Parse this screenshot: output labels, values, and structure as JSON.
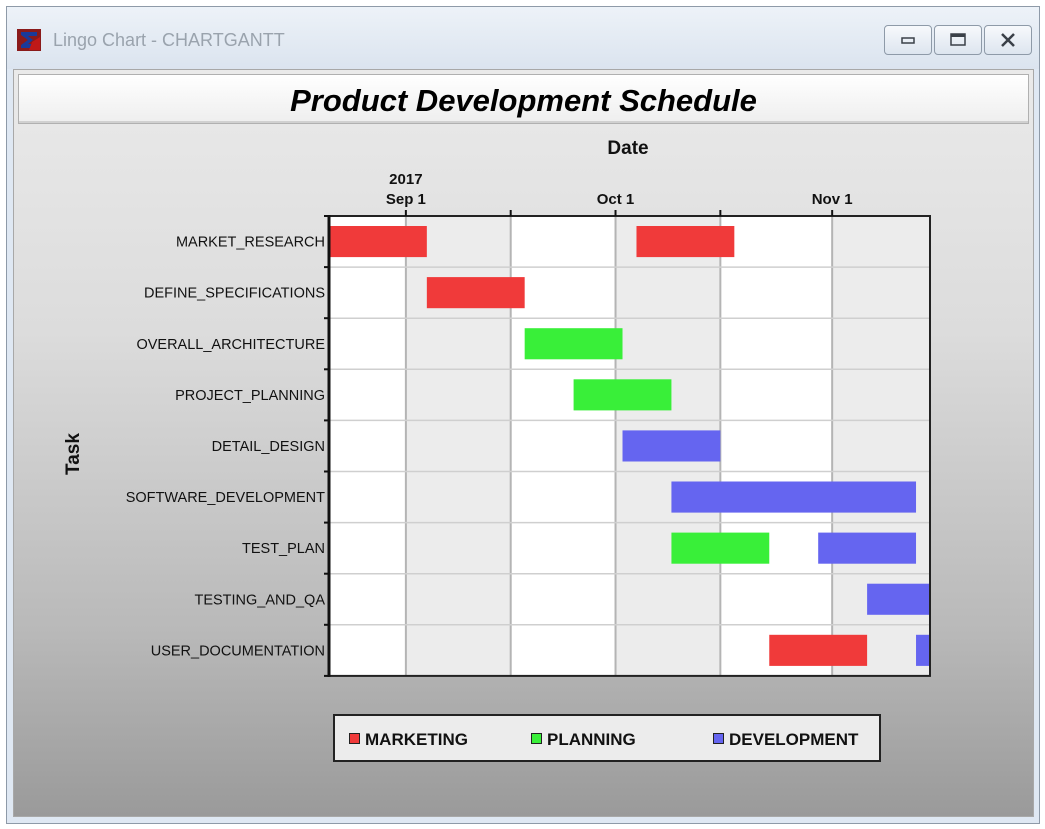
{
  "window": {
    "title": "Lingo Chart - CHARTGANTT",
    "buttons": {
      "minimize": "minimize-icon",
      "maximize": "maximize-icon",
      "close": "close-icon"
    }
  },
  "chart_data": {
    "type": "gantt",
    "title": "Product Development Schedule",
    "xlabel": "Date",
    "ylabel": "Task",
    "date_range": [
      "2017-08-21",
      "2017-11-15"
    ],
    "ticks": [
      {
        "date": "2017-09-01",
        "labels": [
          "2017",
          "Sep 1"
        ]
      },
      {
        "date": "2017-10-01",
        "labels": [
          "Oct 1"
        ]
      },
      {
        "date": "2017-11-01",
        "labels": [
          "Nov 1"
        ]
      }
    ],
    "gridlines": [
      "2017-09-01",
      "2017-09-16",
      "2017-10-01",
      "2017-10-16",
      "2017-11-01",
      "2017-11-16"
    ],
    "grid": true,
    "legend_position": "bottom",
    "categories": [
      {
        "name": "MARKETING",
        "color": "#f03a3a"
      },
      {
        "name": "PLANNING",
        "color": "#39ef39"
      },
      {
        "name": "DEVELOPMENT",
        "color": "#6565f0"
      }
    ],
    "tasks": [
      {
        "name": "MARKET_RESEARCH",
        "bars": [
          {
            "start": "2017-08-21",
            "end": "2017-09-04",
            "category": "MARKETING"
          },
          {
            "start": "2017-10-04",
            "end": "2017-10-18",
            "category": "MARKETING"
          }
        ]
      },
      {
        "name": "DEFINE_SPECIFICATIONS",
        "bars": [
          {
            "start": "2017-09-04",
            "end": "2017-09-18",
            "category": "MARKETING"
          }
        ]
      },
      {
        "name": "OVERALL_ARCHITECTURE",
        "bars": [
          {
            "start": "2017-09-18",
            "end": "2017-10-02",
            "category": "PLANNING"
          }
        ]
      },
      {
        "name": "PROJECT_PLANNING",
        "bars": [
          {
            "start": "2017-09-25",
            "end": "2017-10-09",
            "category": "PLANNING"
          }
        ]
      },
      {
        "name": "DETAIL_DESIGN",
        "bars": [
          {
            "start": "2017-10-02",
            "end": "2017-10-16",
            "category": "DEVELOPMENT"
          }
        ]
      },
      {
        "name": "SOFTWARE_DEVELOPMENT",
        "bars": [
          {
            "start": "2017-10-09",
            "end": "2017-11-13",
            "category": "DEVELOPMENT"
          }
        ]
      },
      {
        "name": "TEST_PLAN",
        "bars": [
          {
            "start": "2017-10-09",
            "end": "2017-10-23",
            "category": "PLANNING"
          },
          {
            "start": "2017-10-30",
            "end": "2017-11-13",
            "category": "DEVELOPMENT"
          }
        ]
      },
      {
        "name": "TESTING_AND_QA",
        "bars": [
          {
            "start": "2017-11-06",
            "end": "2017-11-27",
            "category": "DEVELOPMENT"
          }
        ]
      },
      {
        "name": "USER_DOCUMENTATION",
        "bars": [
          {
            "start": "2017-10-23",
            "end": "2017-11-06",
            "category": "MARKETING"
          },
          {
            "start": "2017-11-13",
            "end": "2017-11-27",
            "category": "DEVELOPMENT"
          }
        ]
      }
    ]
  }
}
